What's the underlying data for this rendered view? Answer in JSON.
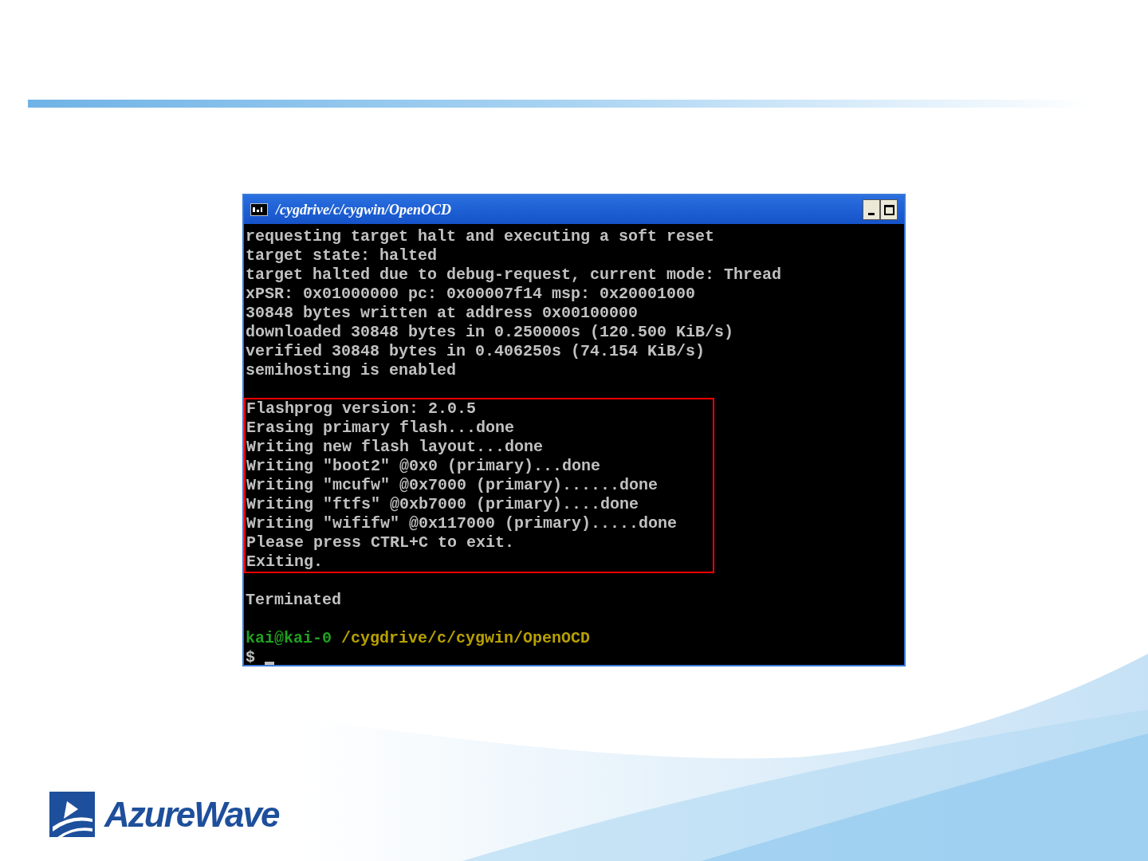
{
  "window": {
    "title": "/cygdrive/c/cygwin/OpenOCD"
  },
  "terminal": {
    "output": [
      "requesting target halt and executing a soft reset",
      "target state: halted",
      "target halted due to debug-request, current mode: Thread",
      "xPSR: 0x01000000 pc: 0x00007f14 msp: 0x20001000",
      "30848 bytes written at address 0x00100000",
      "downloaded 30848 bytes in 0.250000s (120.500 KiB/s)",
      "verified 30848 bytes in 0.406250s (74.154 KiB/s)",
      "semihosting is enabled"
    ],
    "framed_output": [
      "Flashprog version: 2.0.5",
      "Erasing primary flash...done",
      "Writing new flash layout...done",
      "Writing \"boot2\" @0x0 (primary)...done",
      "Writing \"mcufw\" @0x7000 (primary)......done",
      "Writing \"ftfs\" @0xb7000 (primary)....done",
      "Writing \"wififw\" @0x117000 (primary).....done",
      "Please press CTRL+C to exit.",
      "Exiting."
    ],
    "final_output": [
      "Terminated"
    ],
    "prompt": {
      "user": "kai@kai-0",
      "path": "/cygdrive/c/cygwin/OpenOCD",
      "symbol": "$"
    }
  },
  "logo": {
    "text": "AzureWave"
  }
}
